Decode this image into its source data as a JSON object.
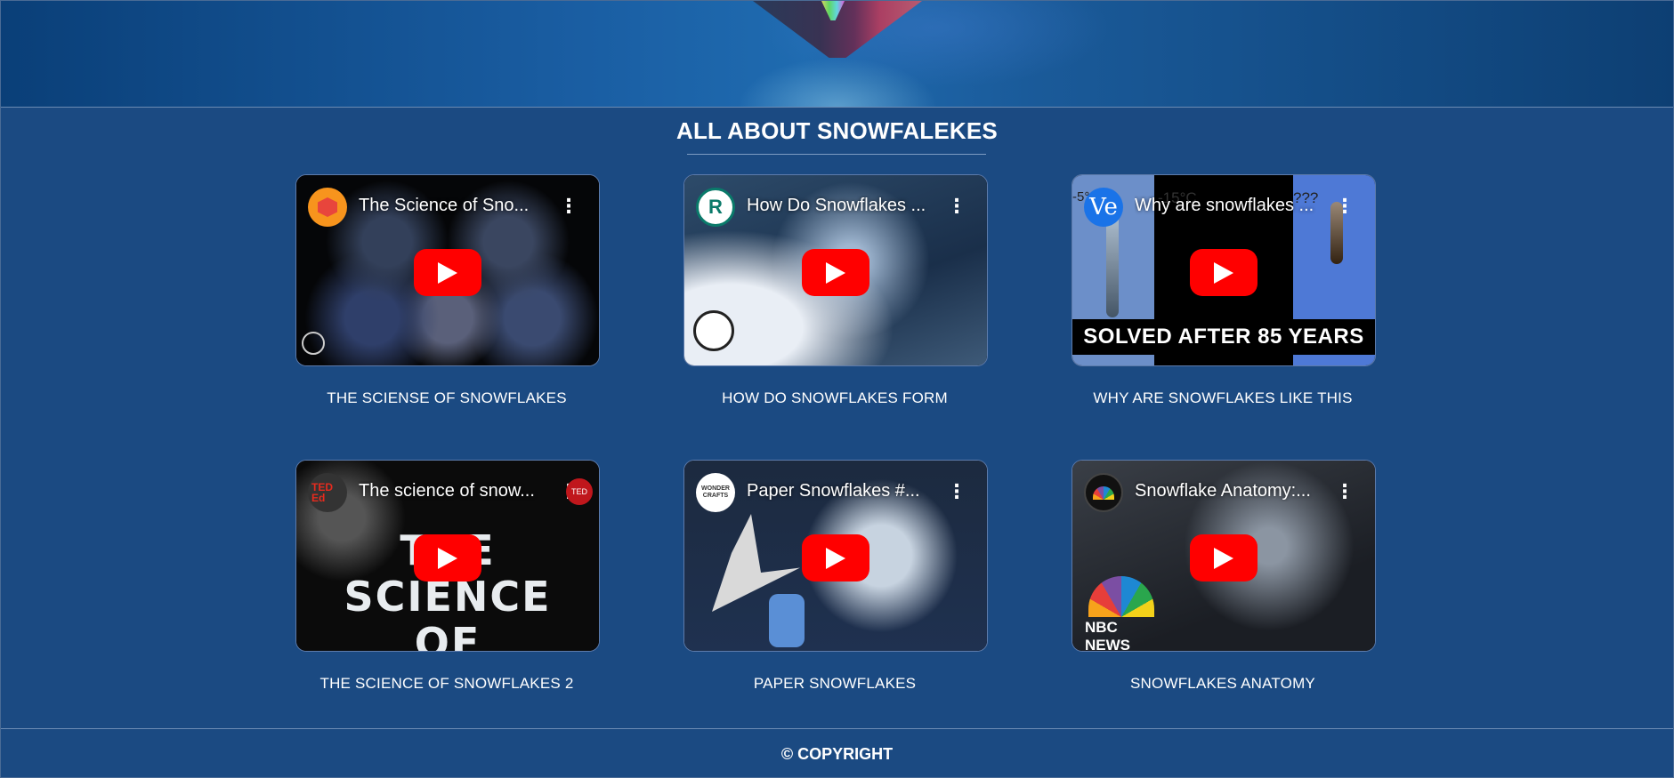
{
  "page": {
    "section_title": "ALL ABOUT SNOWFALEKES",
    "footer": "© COPYRIGHT"
  },
  "videos": [
    {
      "caption": "THE SCIENSE OF SNOWFLAKES",
      "video_title": "The Science of Sno...",
      "channel_icon": "pbs-hexagon-icon"
    },
    {
      "caption": "HOW DO SNOWFLAKES FORM",
      "video_title": "How Do Snowflakes ...",
      "channel_icon": "reactions-r-icon",
      "channel_letter": "R"
    },
    {
      "caption": "WHY ARE SNOWFLAKES LIKE THIS",
      "video_title": "Why are snowflakes ...",
      "channel_icon": "veritasium-ve-icon",
      "channel_letter": "Ve",
      "overlay_text": "SOLVED AFTER 85 YEARS",
      "temp_labels": [
        "-5°",
        "-15°C",
        "???"
      ]
    },
    {
      "caption": "THE SCIENCE OF SNOWFLAKES 2",
      "video_title": "The science of snow...",
      "channel_icon": "ted-ed-icon",
      "channel_letter": "TED Ed",
      "overlay_text": "THE SCIENCE OF SNOWFLAKES"
    },
    {
      "caption": "PAPER SNOWFLAKES",
      "video_title": "Paper Snowflakes #...",
      "channel_icon": "wonder-crafts-icon",
      "channel_letter": "WONDER CRAFTS"
    },
    {
      "caption": "SNOWFLAKES ANATOMY",
      "video_title": "Snowflake Anatomy:...",
      "channel_icon": "nbc-news-icon",
      "overlay_text": "NBC NEWS"
    }
  ],
  "colors": {
    "background": "#1b4a82",
    "play_button": "#ff0000"
  }
}
